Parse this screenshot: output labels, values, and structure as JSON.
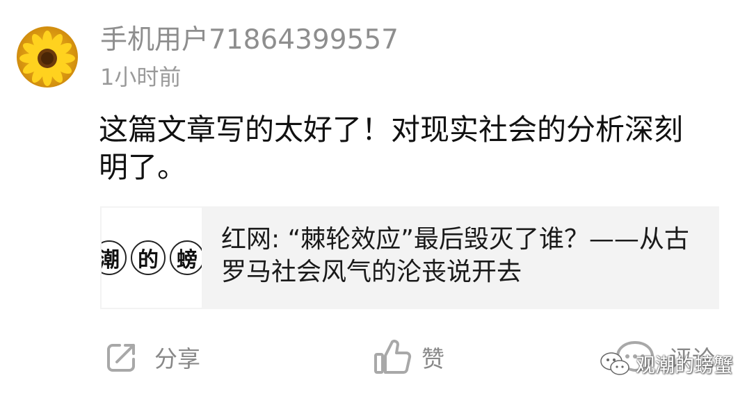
{
  "comment_item": {
    "avatar_icon": "sunflower-avatar",
    "username": "手机用户71864399557",
    "timestamp": "1小时前",
    "text": "这篇文章写的太好了！对现实社会的分析深刻明了。"
  },
  "linked_article": {
    "thumbnail_chars": [
      "潮",
      "的",
      "螃"
    ],
    "title": "红网: “棘轮效应”最后毁灭了谁？——从古罗马社会风气的沦丧说开去"
  },
  "actions": {
    "share": {
      "icon": "share-icon",
      "label": "分享"
    },
    "like": {
      "icon": "thumbs-up-icon",
      "label": "赞"
    },
    "comment": {
      "icon": "comment-icon",
      "label": "评论"
    }
  },
  "watermark": {
    "icon": "wechat-icon",
    "text": "观潮的螃蟹"
  },
  "colors": {
    "meta_text": "#8e8e8e",
    "body_text": "#111111",
    "card_bg": "#f3f3f3",
    "icon_gray": "#a8a8a8"
  }
}
